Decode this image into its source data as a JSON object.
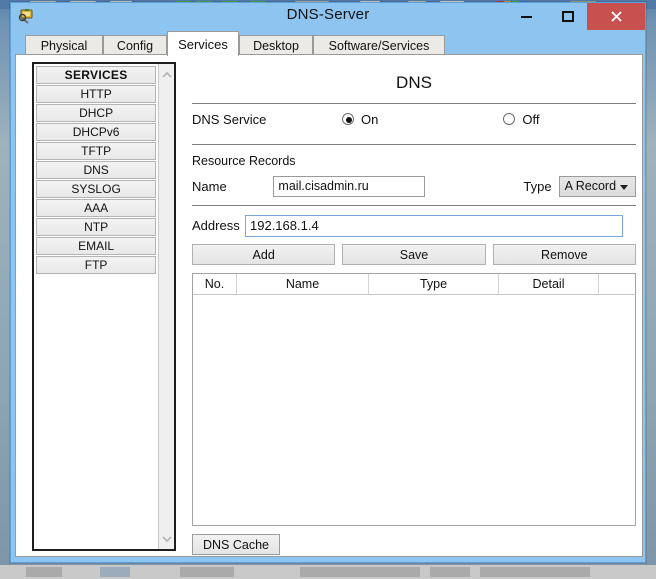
{
  "window": {
    "title": "DNS-Server",
    "app_icon": "network-device-icon",
    "minimize_label": "Minimize",
    "maximize_label": "Maximize",
    "close_label": "Close",
    "close_color": "#c8504f",
    "titlebar_color": "#8ec5f0"
  },
  "tabs": [
    {
      "label": "Physical",
      "active": false
    },
    {
      "label": "Config",
      "active": false
    },
    {
      "label": "Services",
      "active": true
    },
    {
      "label": "Desktop",
      "active": false
    },
    {
      "label": "Software/Services",
      "active": false
    }
  ],
  "sidebar": {
    "header": "SERVICES",
    "items": [
      {
        "label": "HTTP"
      },
      {
        "label": "DHCP"
      },
      {
        "label": "DHCPv6"
      },
      {
        "label": "TFTP"
      },
      {
        "label": "DNS"
      },
      {
        "label": "SYSLOG"
      },
      {
        "label": "AAA"
      },
      {
        "label": "NTP"
      },
      {
        "label": "EMAIL"
      },
      {
        "label": "FTP"
      }
    ],
    "scroll_up_icon": "chevron-up-icon",
    "scroll_down_icon": "chevron-down-icon"
  },
  "panel": {
    "title": "DNS",
    "service_label": "DNS Service",
    "service_state": "On",
    "radio_on_label": "On",
    "radio_off_label": "Off",
    "resource_records_label": "Resource Records",
    "name_label": "Name",
    "name_value": "mail.cisadmin.ru",
    "name_placeholder": "",
    "type_label": "Type",
    "type_value": "A Record",
    "address_label": "Address",
    "address_value": "192.168.1.4",
    "address_placeholder": "",
    "buttons": [
      {
        "label": "Add"
      },
      {
        "label": "Save"
      },
      {
        "label": "Remove"
      }
    ],
    "table": {
      "columns": [
        {
          "label": "No.",
          "width": 44
        },
        {
          "label": "Name",
          "width": 132
        },
        {
          "label": "Type",
          "width": 130
        },
        {
          "label": "Detail",
          "width": 100
        },
        {
          "label": "",
          "width": 36
        }
      ],
      "rows": []
    },
    "dns_cache_label": "DNS Cache"
  }
}
